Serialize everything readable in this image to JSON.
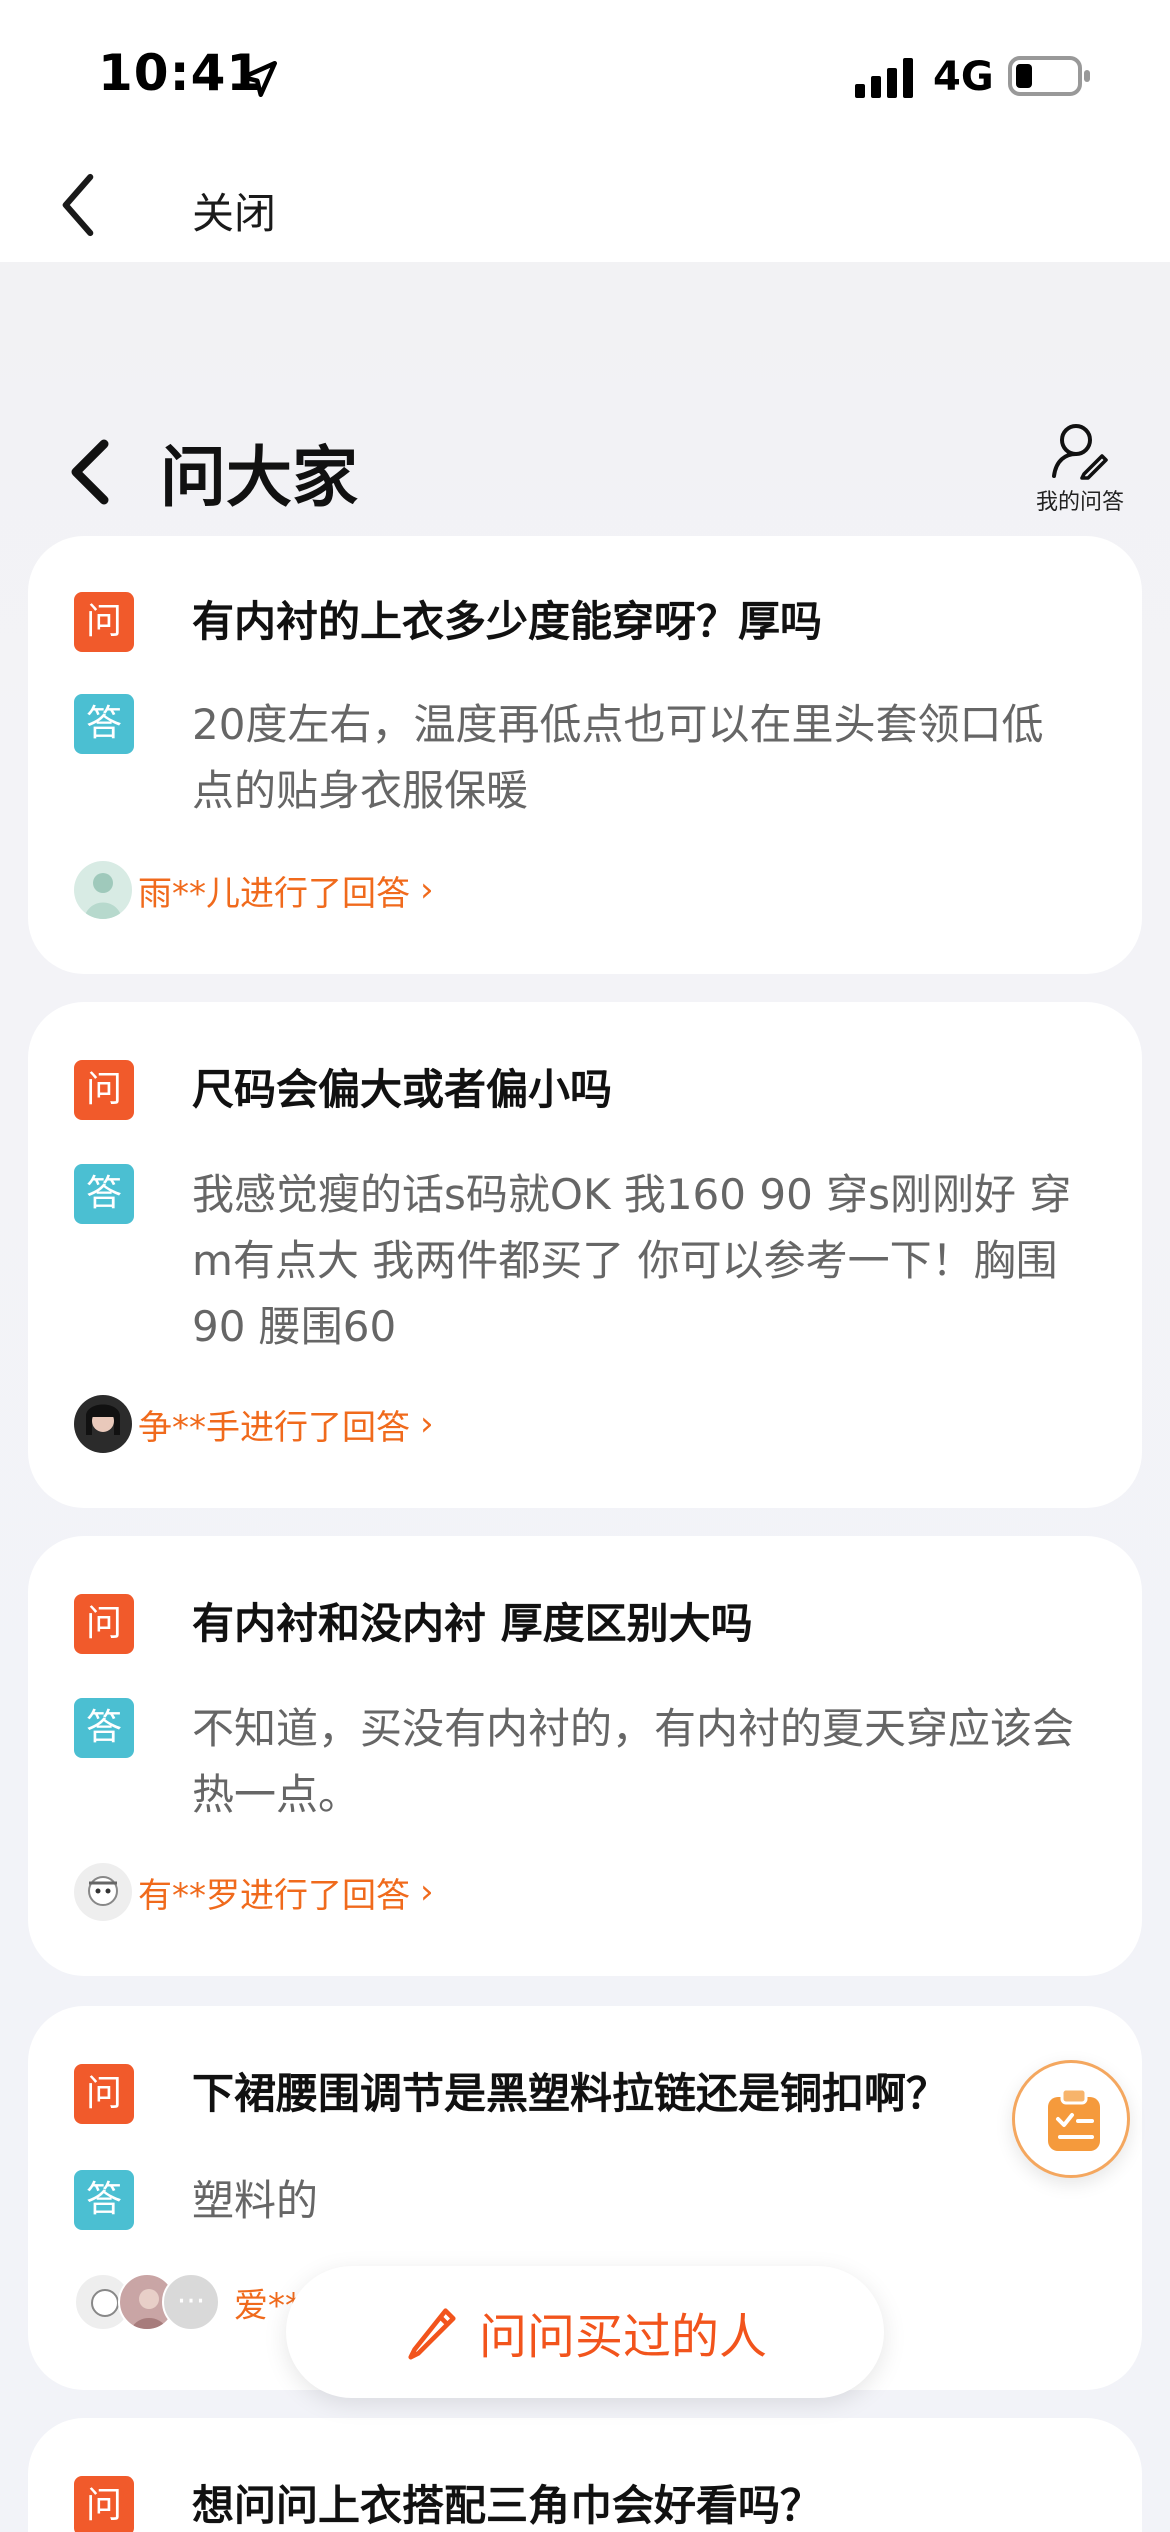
{
  "status_bar": {
    "time": "10:41",
    "network": "4G"
  },
  "nav": {
    "close_label": "关闭"
  },
  "header": {
    "title": "问大家",
    "my_qa_label": "我的问答"
  },
  "qa_items": [
    {
      "question": "有内衬的上衣多少度能穿呀？厚吗",
      "answer": "20度左右，温度再低点也可以在里头套领口低点的贴身衣服保暖",
      "answerer": "雨**儿进行了回答"
    },
    {
      "question": "尺码会偏大或者偏小吗",
      "answer": "我感觉瘦的话s码就OK 我160 90 穿s刚刚好 穿m有点大 我两件都买了 你可以参考一下！胸围90 腰围60",
      "answerer": "争**手进行了回答"
    },
    {
      "question": "有内衬和没内衬 厚度区别大吗",
      "answer": "不知道，买没有内衬的，有内衬的夏天穿应该会热一点。",
      "answerer": "有**罗进行了回答"
    },
    {
      "question": "下裙腰围调节是黑塑料拉链还是铜扣啊？",
      "answer": "塑料的",
      "answerer": "爱**"
    },
    {
      "question": "想问问上衣搭配三角巾会好看吗？"
    }
  ],
  "tags": {
    "question": "问",
    "answer": "答"
  },
  "ask_button": {
    "label": "问问买过的人"
  },
  "colors": {
    "accent": "#f15a2b",
    "answer_tag": "#4bbfd2",
    "answerer_text": "#f06a1c"
  }
}
